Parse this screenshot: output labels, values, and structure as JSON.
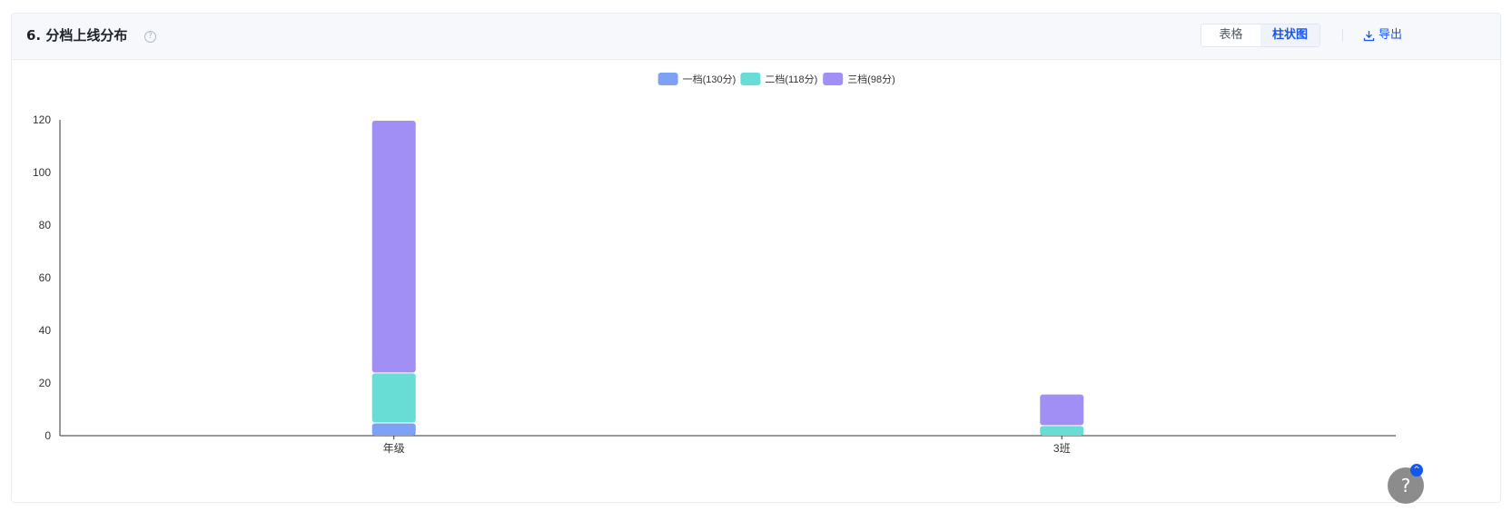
{
  "header": {
    "title": "6. 分档上线分布",
    "help_icon": "question-circle-icon",
    "view_tabs": [
      {
        "label": "表格",
        "active": false
      },
      {
        "label": "柱状图",
        "active": true
      }
    ],
    "export_label": "导出",
    "export_icon": "download-icon"
  },
  "colors": {
    "accent": "#1456f0",
    "series": [
      "#7da2f5",
      "#67ddd5",
      "#a28ff6"
    ]
  },
  "chart_data": {
    "type": "bar",
    "stacked": true,
    "categories": [
      "年级",
      "3班"
    ],
    "series": [
      {
        "name": "一档(130分)",
        "values": [
          5,
          0
        ]
      },
      {
        "name": "二档(118分)",
        "values": [
          19,
          4
        ]
      },
      {
        "name": "三档(98分)",
        "values": [
          96,
          12
        ]
      }
    ],
    "yticks": [
      "0",
      "20",
      "40",
      "60",
      "80",
      "100",
      "120"
    ],
    "ylim": [
      0,
      120
    ],
    "grid": false,
    "legend_position": "top-center"
  },
  "floating_help": {
    "icon": "help-icon",
    "label": "?",
    "badge_icon": "chevron-up-icon",
    "badge_label": "^"
  }
}
